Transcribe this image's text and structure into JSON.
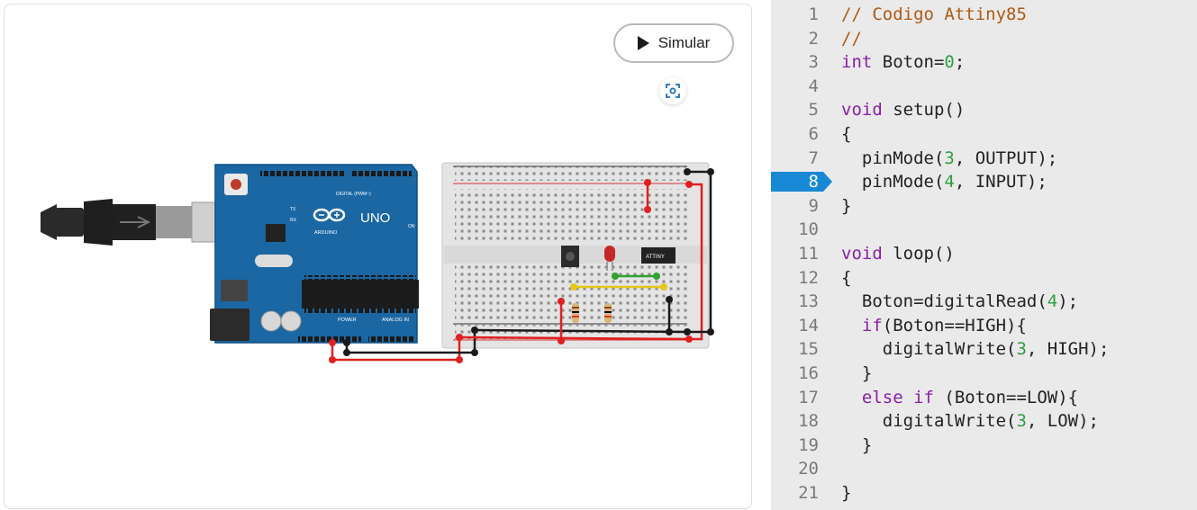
{
  "toolbar": {
    "simulate_label": "Simular",
    "fit_icon": "fit-view-icon"
  },
  "circuit": {
    "arduino": {
      "model_label": "UNO",
      "brand_label": "ARDUINO",
      "digital_label": "DIGITAL (PWM~)",
      "power_label": "POWER",
      "analog_label": "ANALOG IN",
      "on_label": "ON",
      "tx_label": "TX",
      "rx_label": "RX"
    },
    "chip_label": "ATTINY",
    "colors": {
      "arduino_board": "#1b67a3",
      "wire_red": "#e02020",
      "wire_black": "#1a1a1a",
      "wire_green": "#2ea12e",
      "wire_yellow": "#e6c619",
      "led": "#c62828"
    }
  },
  "editor": {
    "current_line": "8",
    "lines": [
      {
        "num": "1",
        "tokens": [
          {
            "t": "// Codigo Attiny85",
            "c": "c-comment"
          }
        ]
      },
      {
        "num": "2",
        "tokens": [
          {
            "t": "//",
            "c": "c-comment"
          }
        ]
      },
      {
        "num": "3",
        "tokens": [
          {
            "t": "int",
            "c": "c-kw"
          },
          {
            "t": " Boton=",
            "c": ""
          },
          {
            "t": "0",
            "c": "c-num"
          },
          {
            "t": ";",
            "c": ""
          }
        ]
      },
      {
        "num": "4",
        "tokens": []
      },
      {
        "num": "5",
        "tokens": [
          {
            "t": "void",
            "c": "c-kw"
          },
          {
            "t": " setup()",
            "c": ""
          }
        ]
      },
      {
        "num": "6",
        "tokens": [
          {
            "t": "{",
            "c": ""
          }
        ]
      },
      {
        "num": "7",
        "tokens": [
          {
            "t": "  pinMode(",
            "c": ""
          },
          {
            "t": "3",
            "c": "c-num"
          },
          {
            "t": ", OUTPUT);",
            "c": ""
          }
        ]
      },
      {
        "num": "8",
        "tokens": [
          {
            "t": "  pinMode(",
            "c": ""
          },
          {
            "t": "4",
            "c": "c-num"
          },
          {
            "t": ", INPUT);",
            "c": ""
          }
        ]
      },
      {
        "num": "9",
        "tokens": [
          {
            "t": "}",
            "c": ""
          }
        ]
      },
      {
        "num": "10",
        "tokens": []
      },
      {
        "num": "11",
        "tokens": [
          {
            "t": "void",
            "c": "c-kw"
          },
          {
            "t": " loop()",
            "c": ""
          }
        ]
      },
      {
        "num": "12",
        "tokens": [
          {
            "t": "{",
            "c": ""
          }
        ]
      },
      {
        "num": "13",
        "tokens": [
          {
            "t": "  Boton=digitalRead(",
            "c": ""
          },
          {
            "t": "4",
            "c": "c-num"
          },
          {
            "t": ");",
            "c": ""
          }
        ]
      },
      {
        "num": "14",
        "tokens": [
          {
            "t": "  ",
            "c": ""
          },
          {
            "t": "if",
            "c": "c-kw"
          },
          {
            "t": "(Boton==HIGH){",
            "c": ""
          }
        ]
      },
      {
        "num": "15",
        "tokens": [
          {
            "t": "    digitalWrite(",
            "c": ""
          },
          {
            "t": "3",
            "c": "c-num"
          },
          {
            "t": ", HIGH);",
            "c": ""
          }
        ]
      },
      {
        "num": "16",
        "tokens": [
          {
            "t": "  }",
            "c": ""
          }
        ]
      },
      {
        "num": "17",
        "tokens": [
          {
            "t": "  ",
            "c": ""
          },
          {
            "t": "else if",
            "c": "c-kw"
          },
          {
            "t": " (Boton==LOW){",
            "c": ""
          }
        ]
      },
      {
        "num": "18",
        "tokens": [
          {
            "t": "    digitalWrite(",
            "c": ""
          },
          {
            "t": "3",
            "c": "c-num"
          },
          {
            "t": ", LOW);",
            "c": ""
          }
        ]
      },
      {
        "num": "19",
        "tokens": [
          {
            "t": "  }",
            "c": ""
          }
        ]
      },
      {
        "num": "20",
        "tokens": []
      },
      {
        "num": "21",
        "tokens": [
          {
            "t": "}",
            "c": ""
          }
        ]
      }
    ]
  }
}
